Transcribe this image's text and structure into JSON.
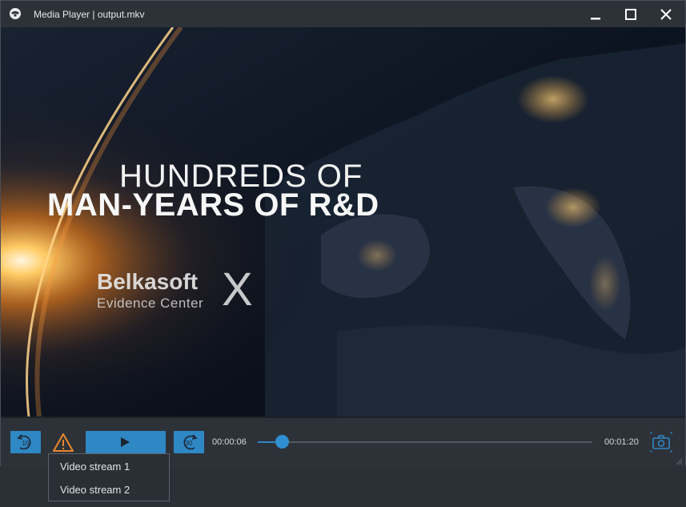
{
  "window": {
    "title": "Media Player | output.mkv"
  },
  "video": {
    "headline_line1": "HUNDREDS OF",
    "headline_line2": "MAN-YEARS OF R&D",
    "brand_name": "Belkasoft",
    "brand_subtitle": "Evidence Center",
    "brand_x": "X"
  },
  "controls": {
    "rewind_label": "10",
    "forward_label": "30",
    "current_time": "00:00:06",
    "total_time": "00:01:20",
    "progress_fraction": 0.075
  },
  "stream_menu": {
    "items": [
      "Video stream 1",
      "Video stream 2"
    ]
  },
  "colors": {
    "accent": "#2f87c4",
    "warning": "#e8892b",
    "background": "#2d3239"
  }
}
